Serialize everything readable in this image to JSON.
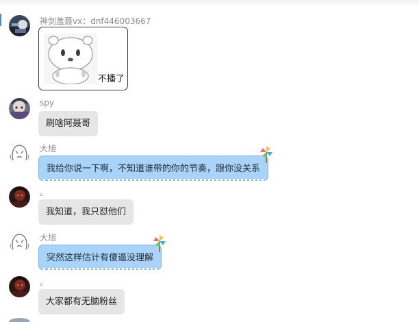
{
  "messages": [
    {
      "sender": "神剑盖聂vx：dnf446003667",
      "type": "sticker",
      "caption": "不播了",
      "avatar_icon": "user-avatar-icon"
    },
    {
      "sender": "spy",
      "type": "text",
      "style": "gray",
      "text": "刷啥阿聂哥",
      "avatar_icon": "anime-avatar-icon"
    },
    {
      "sender": "大旭",
      "type": "text",
      "style": "blue",
      "text": "我给你说一下啊，不知道谁带的你的节奏，跟你没关系",
      "avatar_icon": "sketch-face-avatar-icon"
    },
    {
      "sender": "。",
      "type": "text",
      "style": "gray",
      "text": "我知道，我只怼他们",
      "avatar_icon": "dark-avatar-icon"
    },
    {
      "sender": "大旭",
      "type": "text",
      "style": "blue",
      "text": "突然这样估计有傻逼没理解",
      "avatar_icon": "sketch-face-avatar-icon"
    },
    {
      "sender": "。",
      "type": "text",
      "style": "gray",
      "text": "大家都有无脑粉丝",
      "avatar_icon": "dark-avatar-icon"
    }
  ],
  "colors": {
    "blue_bubble": "#a9d3f9",
    "gray_bubble": "#e6e6e6",
    "name_text": "#8a8a8a"
  }
}
